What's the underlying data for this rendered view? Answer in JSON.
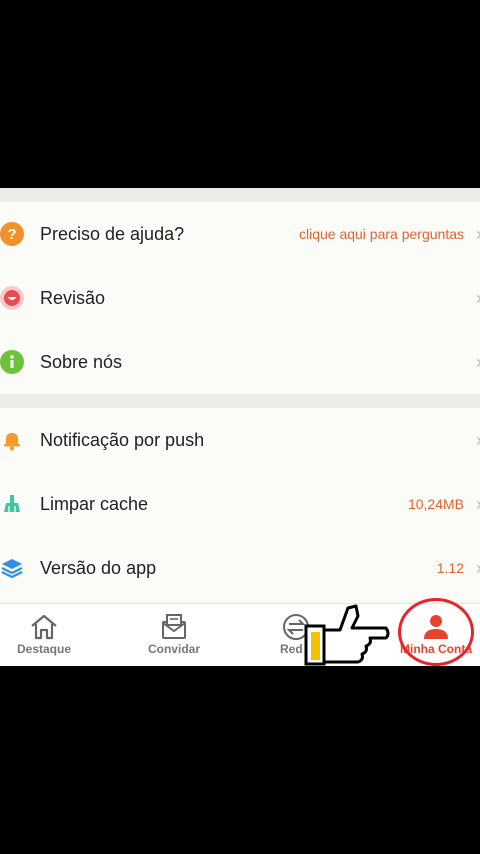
{
  "rows_group1": [
    {
      "label": "Preciso de ajuda?",
      "value": "clique aqui para perguntas",
      "icon": "question-icon",
      "color": "#f0922c"
    },
    {
      "label": "Revisão",
      "value": "",
      "icon": "smile-icon",
      "color": "#ec4a52"
    },
    {
      "label": "Sobre nós",
      "value": "",
      "icon": "info-icon",
      "color": "#6cc23a"
    }
  ],
  "rows_group2": [
    {
      "label": "Notificação por push",
      "value": "",
      "icon": "bell-icon",
      "color": "#f59a2c"
    },
    {
      "label": "Limpar cache",
      "value": "10,24MB",
      "icon": "broom-icon",
      "color": "#3cc7a0"
    },
    {
      "label": "Versão do app",
      "value": "1.12",
      "icon": "layers-icon",
      "color": "#2f8fe6"
    }
  ],
  "bottom_nav": [
    {
      "label": "Destaque",
      "icon": "home-icon"
    },
    {
      "label": "Convidar",
      "icon": "mail-icon"
    },
    {
      "label": "Red",
      "icon": "exchange-icon"
    },
    {
      "label": "Minha Conta",
      "icon": "user-icon",
      "active": true
    }
  ],
  "colors": {
    "accent": "#e8432f",
    "value_text": "#e2632f",
    "annotation": "#e8242a"
  }
}
